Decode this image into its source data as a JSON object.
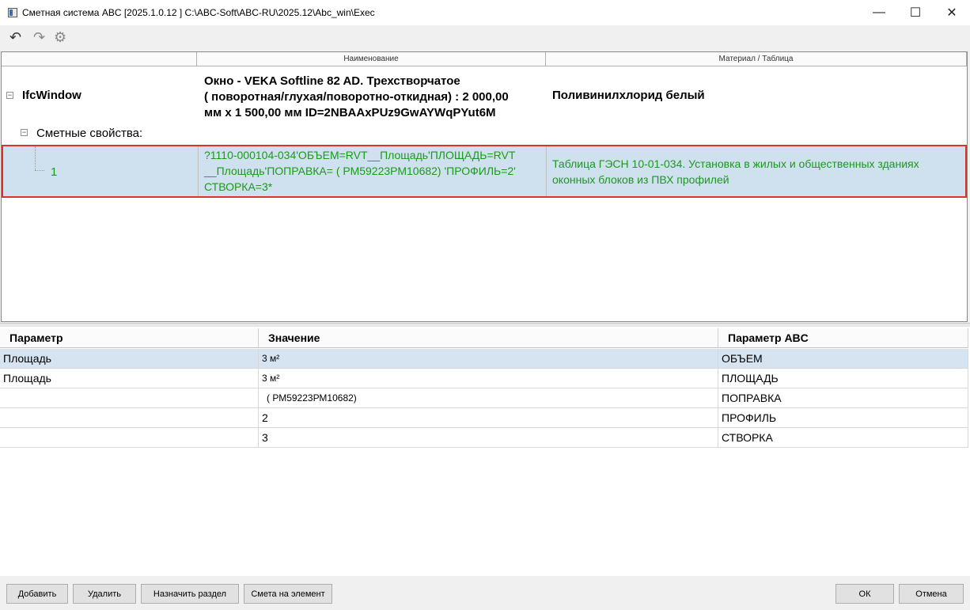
{
  "window": {
    "title": "Сметная система ABC [2025.1.0.12 ]   C:\\ABC-Soft\\ABC-RU\\2025.12\\Abc_win\\Exec",
    "min_glyph": "—",
    "max_glyph": "☐",
    "close_glyph": "✕"
  },
  "toolbar": {
    "undo_glyph": "↶",
    "redo_glyph": "↷",
    "settings_glyph": "⚙"
  },
  "tree": {
    "columns": [
      "",
      "Наименование",
      "Материал / Таблица"
    ],
    "root": {
      "name": "IfcWindow",
      "description_lines": [
        "Окно - VEKA Softline 82 AD. Трехстворчатое",
        "( поворотная/глухая/поворотно-откидная)  : 2 000,00",
        "мм x 1 500,00 мм  ID=2NBAAxPUz9GwAYWqPYut6M"
      ],
      "material": "Поливинилхлорид белый"
    },
    "group": {
      "label": "Сметные свойства:"
    },
    "item": {
      "number": "1",
      "formula_lines": [
        "?1110-000104-034'ОБЪЕМ=RVT__Площадь'ПЛОЩАДЬ=RVT",
        "__Площадь'ПОПРАВКА= ( РМ59223РМ10682)  'ПРОФИЛЬ=2'",
        "СТВОРКА=3*"
      ],
      "table_lines": [
        "Таблица ГЭСН 10-01-034. Установка в жилых и общественных зданиях",
        "оконных блоков из ПВХ профилей"
      ]
    },
    "expander_glyph": "−"
  },
  "params": {
    "headers": [
      "Параметр",
      "Значение",
      "Параметр ABC"
    ],
    "rows": [
      [
        "Площадь",
        "3  м²",
        "ОБЪЕМ"
      ],
      [
        "Площадь",
        "3  м²",
        "ПЛОЩАДЬ"
      ],
      [
        "",
        "( РМ59223РМ10682)",
        "ПОПРАВКА"
      ],
      [
        "",
        "2",
        "ПРОФИЛЬ"
      ],
      [
        "",
        "3",
        "СТВОРКА"
      ]
    ]
  },
  "buttons": {
    "add": "Добавить",
    "delete": "Удалить",
    "assign_section": "Назначить раздел",
    "estimate_for_element": "Смета на элемент",
    "ok": "ОК",
    "cancel": "Отмена"
  },
  "colors": {
    "accent_green": "#1a9a1a",
    "selection": "#cfe0ef",
    "highlight_border": "#d9342b"
  }
}
